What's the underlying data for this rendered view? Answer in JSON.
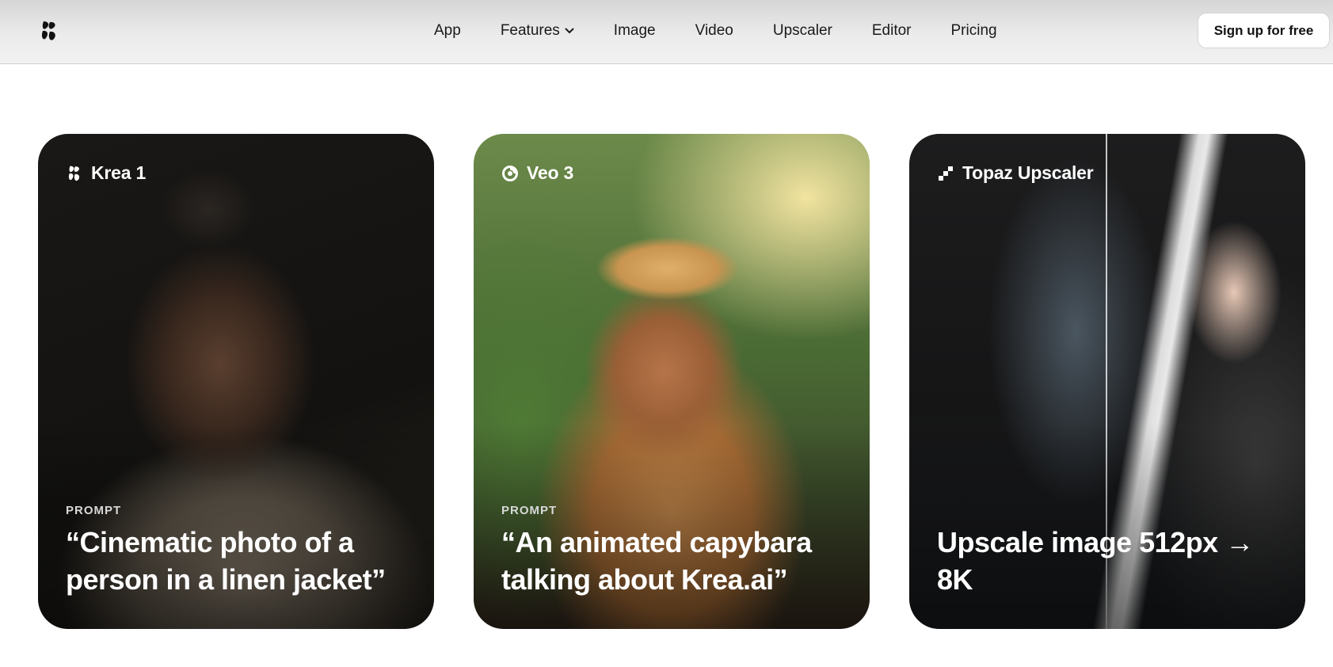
{
  "header": {
    "nav": [
      {
        "label": "App"
      },
      {
        "label": "Features",
        "has_dropdown": true
      },
      {
        "label": "Image"
      },
      {
        "label": "Video"
      },
      {
        "label": "Upscaler"
      },
      {
        "label": "Editor"
      },
      {
        "label": "Pricing"
      }
    ],
    "signup_label": "Sign up for free"
  },
  "cards": [
    {
      "badge": "Krea 1",
      "badge_icon": "krea-logo-icon",
      "prompt_label": "PROMPT",
      "caption": "“Cinematic photo of a person in a linen jacket”"
    },
    {
      "badge": "Veo 3",
      "badge_icon": "veo-swirl-icon",
      "prompt_label": "PROMPT",
      "caption": "“An animated capybara talking about Krea.ai”"
    },
    {
      "badge": "Topaz Upscaler",
      "badge_icon": "pixel-steps-icon",
      "caption": "Upscale image 512px → 8K"
    }
  ],
  "colors": {
    "header_bg": "#e6e6e6",
    "text": "#1a1a1a",
    "card_text": "#ffffff"
  }
}
